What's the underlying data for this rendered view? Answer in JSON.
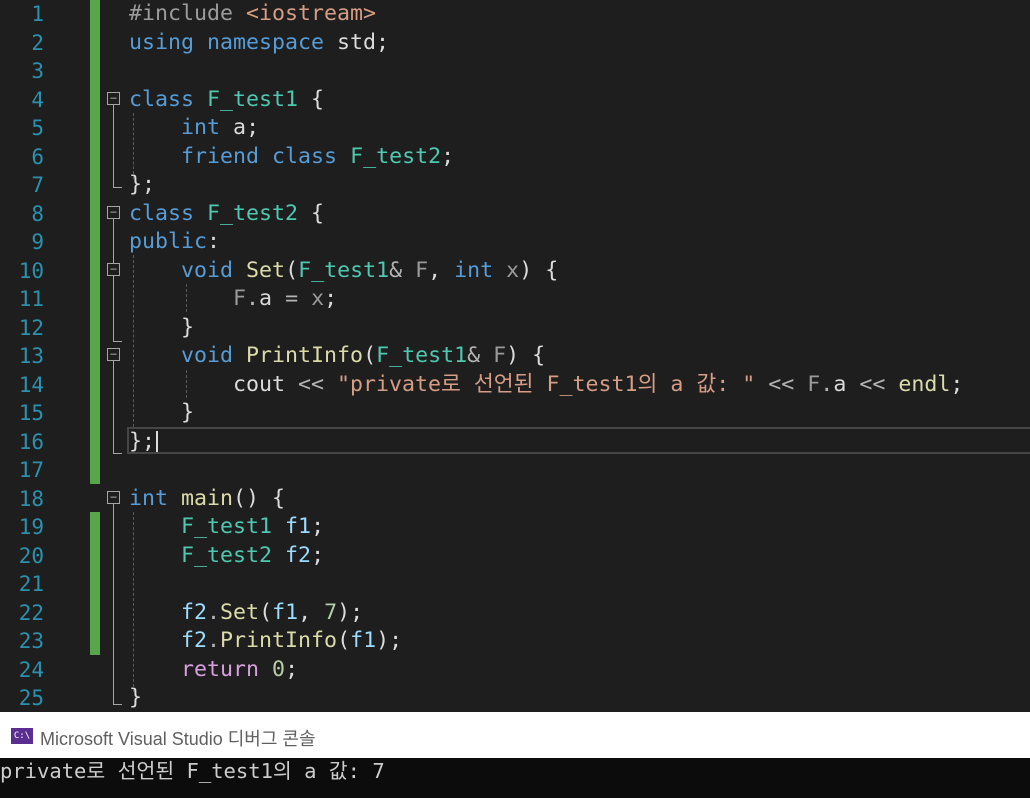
{
  "editor": {
    "lines": [
      {
        "n": "1",
        "tokens": [
          {
            "t": "#include ",
            "c": "pp"
          },
          {
            "t": "<iostream>",
            "c": "inc"
          }
        ]
      },
      {
        "n": "2",
        "tokens": [
          {
            "t": "using",
            "c": "kw"
          },
          {
            "t": " ",
            "c": "plain"
          },
          {
            "t": "namespace",
            "c": "kw"
          },
          {
            "t": " std;",
            "c": "plain"
          }
        ]
      },
      {
        "n": "3",
        "tokens": []
      },
      {
        "n": "4",
        "tokens": [
          {
            "t": "class",
            "c": "kw"
          },
          {
            "t": " ",
            "c": "plain"
          },
          {
            "t": "F_test1",
            "c": "type"
          },
          {
            "t": " {",
            "c": "plain"
          }
        ]
      },
      {
        "n": "5",
        "tokens": [
          {
            "t": "    ",
            "c": "plain"
          },
          {
            "t": "int",
            "c": "kw"
          },
          {
            "t": " ",
            "c": "plain"
          },
          {
            "t": "a",
            "c": "field"
          },
          {
            "t": ";",
            "c": "plain"
          }
        ]
      },
      {
        "n": "6",
        "tokens": [
          {
            "t": "    ",
            "c": "plain"
          },
          {
            "t": "friend",
            "c": "kw"
          },
          {
            "t": " ",
            "c": "plain"
          },
          {
            "t": "class",
            "c": "kw"
          },
          {
            "t": " ",
            "c": "plain"
          },
          {
            "t": "F_test2",
            "c": "type"
          },
          {
            "t": ";",
            "c": "plain"
          }
        ]
      },
      {
        "n": "7",
        "tokens": [
          {
            "t": "};",
            "c": "plain"
          }
        ]
      },
      {
        "n": "8",
        "tokens": [
          {
            "t": "class",
            "c": "kw"
          },
          {
            "t": " ",
            "c": "plain"
          },
          {
            "t": "F_test2",
            "c": "type"
          },
          {
            "t": " {",
            "c": "plain"
          }
        ]
      },
      {
        "n": "9",
        "tokens": [
          {
            "t": "public",
            "c": "kw"
          },
          {
            "t": ":",
            "c": "plain"
          }
        ]
      },
      {
        "n": "10",
        "tokens": [
          {
            "t": "    ",
            "c": "plain"
          },
          {
            "t": "void",
            "c": "kw"
          },
          {
            "t": " ",
            "c": "plain"
          },
          {
            "t": "Set",
            "c": "fn"
          },
          {
            "t": "(",
            "c": "plain"
          },
          {
            "t": "F_test1",
            "c": "type"
          },
          {
            "t": "& ",
            "c": "op"
          },
          {
            "t": "F",
            "c": "param"
          },
          {
            "t": ", ",
            "c": "plain"
          },
          {
            "t": "int",
            "c": "kw"
          },
          {
            "t": " ",
            "c": "plain"
          },
          {
            "t": "x",
            "c": "param"
          },
          {
            "t": ") {",
            "c": "plain"
          }
        ]
      },
      {
        "n": "11",
        "tokens": [
          {
            "t": "        ",
            "c": "plain"
          },
          {
            "t": "F",
            "c": "param"
          },
          {
            "t": ".",
            "c": "op"
          },
          {
            "t": "a",
            "c": "field"
          },
          {
            "t": " = ",
            "c": "op"
          },
          {
            "t": "x",
            "c": "param"
          },
          {
            "t": ";",
            "c": "plain"
          }
        ]
      },
      {
        "n": "12",
        "tokens": [
          {
            "t": "    }",
            "c": "plain"
          }
        ]
      },
      {
        "n": "13",
        "tokens": [
          {
            "t": "    ",
            "c": "plain"
          },
          {
            "t": "void",
            "c": "kw"
          },
          {
            "t": " ",
            "c": "plain"
          },
          {
            "t": "PrintInfo",
            "c": "fn"
          },
          {
            "t": "(",
            "c": "plain"
          },
          {
            "t": "F_test1",
            "c": "type"
          },
          {
            "t": "& ",
            "c": "op"
          },
          {
            "t": "F",
            "c": "param"
          },
          {
            "t": ") {",
            "c": "plain"
          }
        ]
      },
      {
        "n": "14",
        "tokens": [
          {
            "t": "        ",
            "c": "plain"
          },
          {
            "t": "cout",
            "c": "plain"
          },
          {
            "t": " << ",
            "c": "op"
          },
          {
            "t": "\"private로 선언된 F_test1의 a 값: \"",
            "c": "str"
          },
          {
            "t": " << ",
            "c": "op"
          },
          {
            "t": "F",
            "c": "param"
          },
          {
            "t": ".",
            "c": "op"
          },
          {
            "t": "a",
            "c": "field"
          },
          {
            "t": " << ",
            "c": "op"
          },
          {
            "t": "endl",
            "c": "fn"
          },
          {
            "t": ";",
            "c": "plain"
          }
        ]
      },
      {
        "n": "15",
        "tokens": [
          {
            "t": "    }",
            "c": "plain"
          }
        ]
      },
      {
        "n": "16",
        "tokens": [
          {
            "t": "};",
            "c": "plain"
          }
        ]
      },
      {
        "n": "17",
        "tokens": []
      },
      {
        "n": "18",
        "tokens": [
          {
            "t": "int",
            "c": "kw"
          },
          {
            "t": " ",
            "c": "plain"
          },
          {
            "t": "main",
            "c": "fn"
          },
          {
            "t": "() {",
            "c": "plain"
          }
        ]
      },
      {
        "n": "19",
        "tokens": [
          {
            "t": "    ",
            "c": "plain"
          },
          {
            "t": "F_test1",
            "c": "type"
          },
          {
            "t": " ",
            "c": "plain"
          },
          {
            "t": "f1",
            "c": "var"
          },
          {
            "t": ";",
            "c": "plain"
          }
        ]
      },
      {
        "n": "20",
        "tokens": [
          {
            "t": "    ",
            "c": "plain"
          },
          {
            "t": "F_test2",
            "c": "type"
          },
          {
            "t": " ",
            "c": "plain"
          },
          {
            "t": "f2",
            "c": "var"
          },
          {
            "t": ";",
            "c": "plain"
          }
        ]
      },
      {
        "n": "21",
        "tokens": []
      },
      {
        "n": "22",
        "tokens": [
          {
            "t": "    ",
            "c": "plain"
          },
          {
            "t": "f2",
            "c": "var"
          },
          {
            "t": ".",
            "c": "op"
          },
          {
            "t": "Set",
            "c": "fn"
          },
          {
            "t": "(",
            "c": "plain"
          },
          {
            "t": "f1",
            "c": "var"
          },
          {
            "t": ", ",
            "c": "plain"
          },
          {
            "t": "7",
            "c": "num"
          },
          {
            "t": ");",
            "c": "plain"
          }
        ]
      },
      {
        "n": "23",
        "tokens": [
          {
            "t": "    ",
            "c": "plain"
          },
          {
            "t": "f2",
            "c": "var"
          },
          {
            "t": ".",
            "c": "op"
          },
          {
            "t": "PrintInfo",
            "c": "fn"
          },
          {
            "t": "(",
            "c": "plain"
          },
          {
            "t": "f1",
            "c": "var"
          },
          {
            "t": ");",
            "c": "plain"
          }
        ]
      },
      {
        "n": "24",
        "tokens": [
          {
            "t": "    ",
            "c": "plain"
          },
          {
            "t": "return",
            "c": "ctrl"
          },
          {
            "t": " ",
            "c": "plain"
          },
          {
            "t": "0",
            "c": "num"
          },
          {
            "t": ";",
            "c": "plain"
          }
        ]
      },
      {
        "n": "25",
        "tokens": [
          {
            "t": "}",
            "c": "plain"
          }
        ]
      }
    ]
  },
  "console": {
    "title": "Microsoft Visual Studio 디버그 콘솔",
    "icon_label": "C:\\",
    "output": "private로 선언된 F_test1의 a 값: 7"
  },
  "colors": {
    "background": "#1e1e1e",
    "line_number": "#2b91af",
    "keyword": "#569cd6",
    "type": "#4ec9b0",
    "function": "#dcdcaa",
    "string": "#d69d85",
    "change_bar": "#57a64a",
    "console_icon": "#5c2d91"
  }
}
